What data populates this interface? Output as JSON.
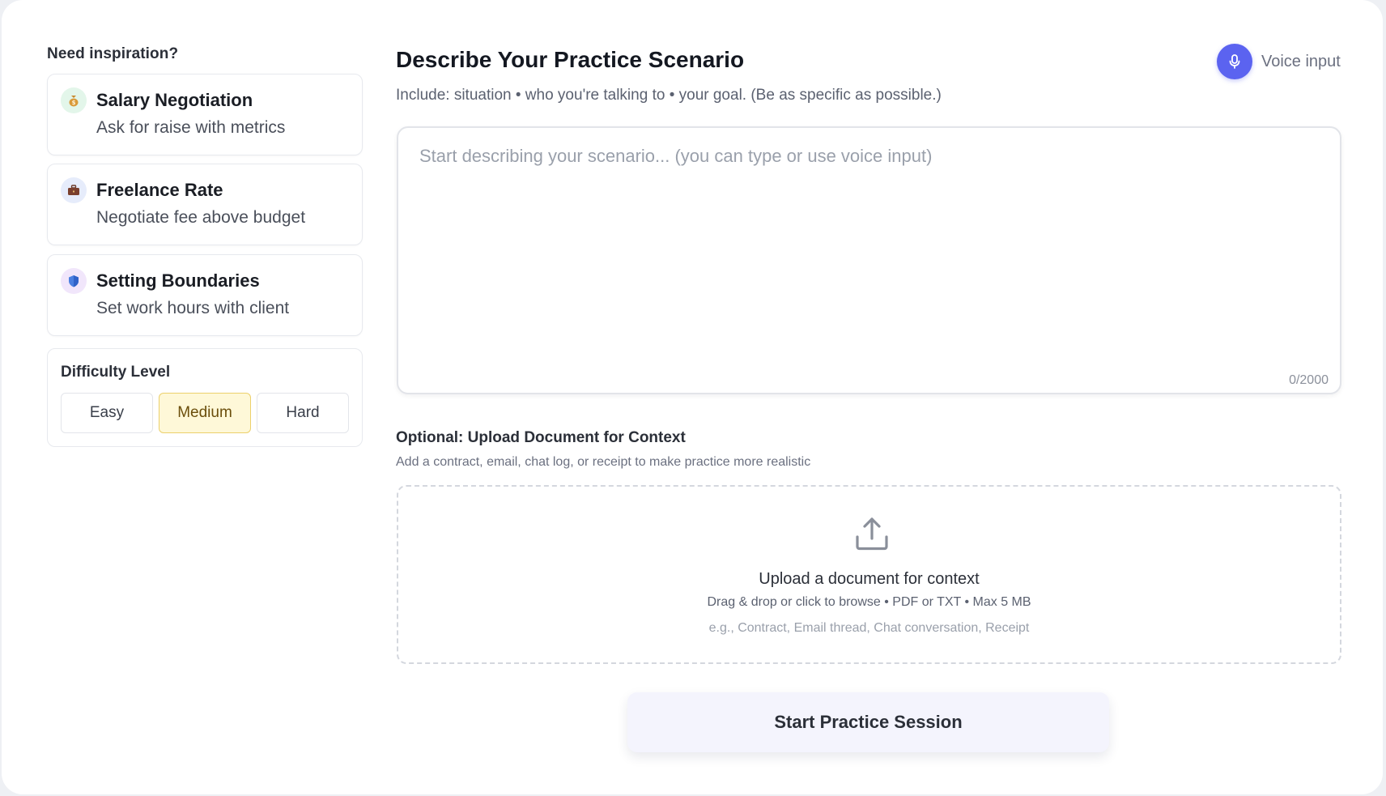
{
  "inspiration": {
    "title": "Need inspiration?",
    "suggestions": [
      {
        "icon": "money-bag-icon",
        "title": "Salary Negotiation",
        "description": "Ask for raise with metrics"
      },
      {
        "icon": "briefcase-icon",
        "title": "Freelance Rate",
        "description": "Negotiate fee above budget"
      },
      {
        "icon": "shield-icon",
        "title": "Setting Boundaries",
        "description": "Set work hours with client"
      }
    ]
  },
  "difficulty": {
    "title": "Difficulty Level",
    "options": [
      "Easy",
      "Medium",
      "Hard"
    ],
    "selected": "Medium"
  },
  "scenario": {
    "title": "Describe Your Practice Scenario",
    "subtitle": "Include: situation • who you're talking to • your goal. (Be as specific as possible.)",
    "placeholder": "Start describing your scenario... (you can type or use voice input)",
    "value": "",
    "counter": "0/2000",
    "voice_label": "Voice input"
  },
  "upload": {
    "title": "Optional: Upload Document for Context",
    "subtitle": "Add a contract, email, chat log, or receipt to make practice more realistic",
    "drop_title": "Upload a document for context",
    "drop_subtitle": "Drag & drop or click to browse • PDF or TXT • Max 5 MB",
    "drop_examples": "e.g., Contract, Email thread, Chat conversation, Receipt"
  },
  "start_button": "Start Practice Session",
  "colors": {
    "accent": "#5b63f0",
    "selected_bg": "#fef8d8",
    "selected_border": "#ecd06b"
  }
}
